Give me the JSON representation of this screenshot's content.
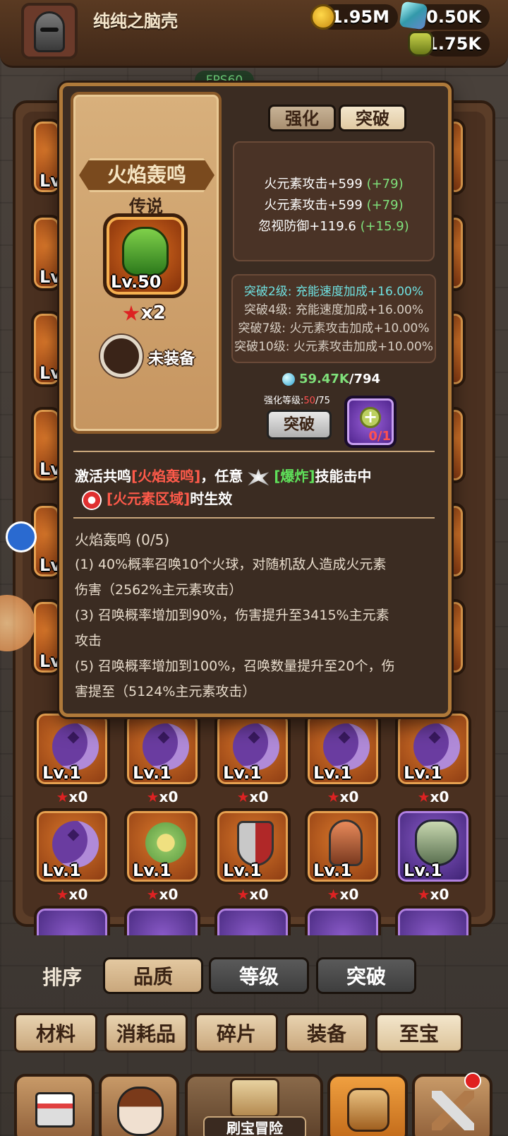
{
  "header": {
    "player_name": "纯纯之脑壳",
    "gold": "1.95M",
    "gems": "70.50K",
    "potion": "1.75K"
  },
  "fps_badge": "FPS60",
  "popup": {
    "tabs": [
      "强化",
      "突破"
    ],
    "item_name": "火焰轰鸣",
    "rarity": "传说",
    "level": "Lv.50",
    "stars": "x2",
    "equip_status": "未装备",
    "stats": [
      {
        "text": "火元素攻击+599",
        "bonus": "(+79)"
      },
      {
        "text": "火元素攻击+599",
        "bonus": "(+79)"
      },
      {
        "text": "忽视防御+119.6",
        "bonus": "(+15.9)"
      }
    ],
    "breakthroughs": [
      {
        "label": "突破2级:",
        "text": "充能速度加成+16.00%"
      },
      {
        "label": "突破4级:",
        "text": "充能速度加成+16.00%"
      },
      {
        "label": "突破7级:",
        "text": "火元素攻击加成+10.00%"
      },
      {
        "label": "突破10级:",
        "text": "火元素攻击加成+10.00%"
      }
    ],
    "material_have": "59.47K",
    "material_need": "/794",
    "enhance_label": "强化等级:",
    "enhance_cur": "50",
    "enhance_max": "/75",
    "break_button": "突破",
    "slot_count": "0/1",
    "effect": {
      "p1": "激活共鸣",
      "p1_red": "[火焰轰鸣]",
      "p1b": "，任意",
      "p2_green": "[爆炸]",
      "p2b": "技能击中",
      "p3_red": "[火元素区域]",
      "p3b": "时生效"
    },
    "set_title": "火焰轰鸣 (0/5)",
    "set_desc": [
      "(1) 40%概率召唤10个火球，对随机敌人造成火元素",
      "伤害（2562%主元素攻击）",
      "(3) 召唤概率增加到90%，伤害提升至3415%主元素",
      "攻击",
      "(5) 召唤概率增加到100%，召唤数量提升至20个，伤",
      "害提至（5124%主元素攻击）"
    ]
  },
  "grid_rows": [
    [
      {
        "level": "Lv.1",
        "count": "x0"
      },
      {
        "level": "Lv.1",
        "count": "x0"
      },
      {
        "level": "Lv.1",
        "count": "x0"
      },
      {
        "level": "Lv.1",
        "count": "x0"
      },
      {
        "level": "Lv.1",
        "count": "x0"
      }
    ],
    [
      {
        "level": "Lv.1",
        "count": "x0"
      },
      {
        "level": "Lv.1",
        "count": "x0"
      },
      {
        "level": "Lv.1",
        "count": "x0"
      },
      {
        "level": "Lv.1",
        "count": "x0"
      },
      {
        "level": "Lv.1",
        "count": "x0"
      }
    ]
  ],
  "side_labels": [
    "Lv",
    "Lv",
    "Lv",
    "Lv",
    "Lv",
    "Lv"
  ],
  "sort": {
    "label": "排序",
    "options": [
      "品质",
      "等级",
      "突破"
    ]
  },
  "tabs": [
    "材料",
    "消耗品",
    "碎片",
    "装备",
    "至宝"
  ],
  "bottom_nav": {
    "center_label": "刷宝冒险"
  }
}
